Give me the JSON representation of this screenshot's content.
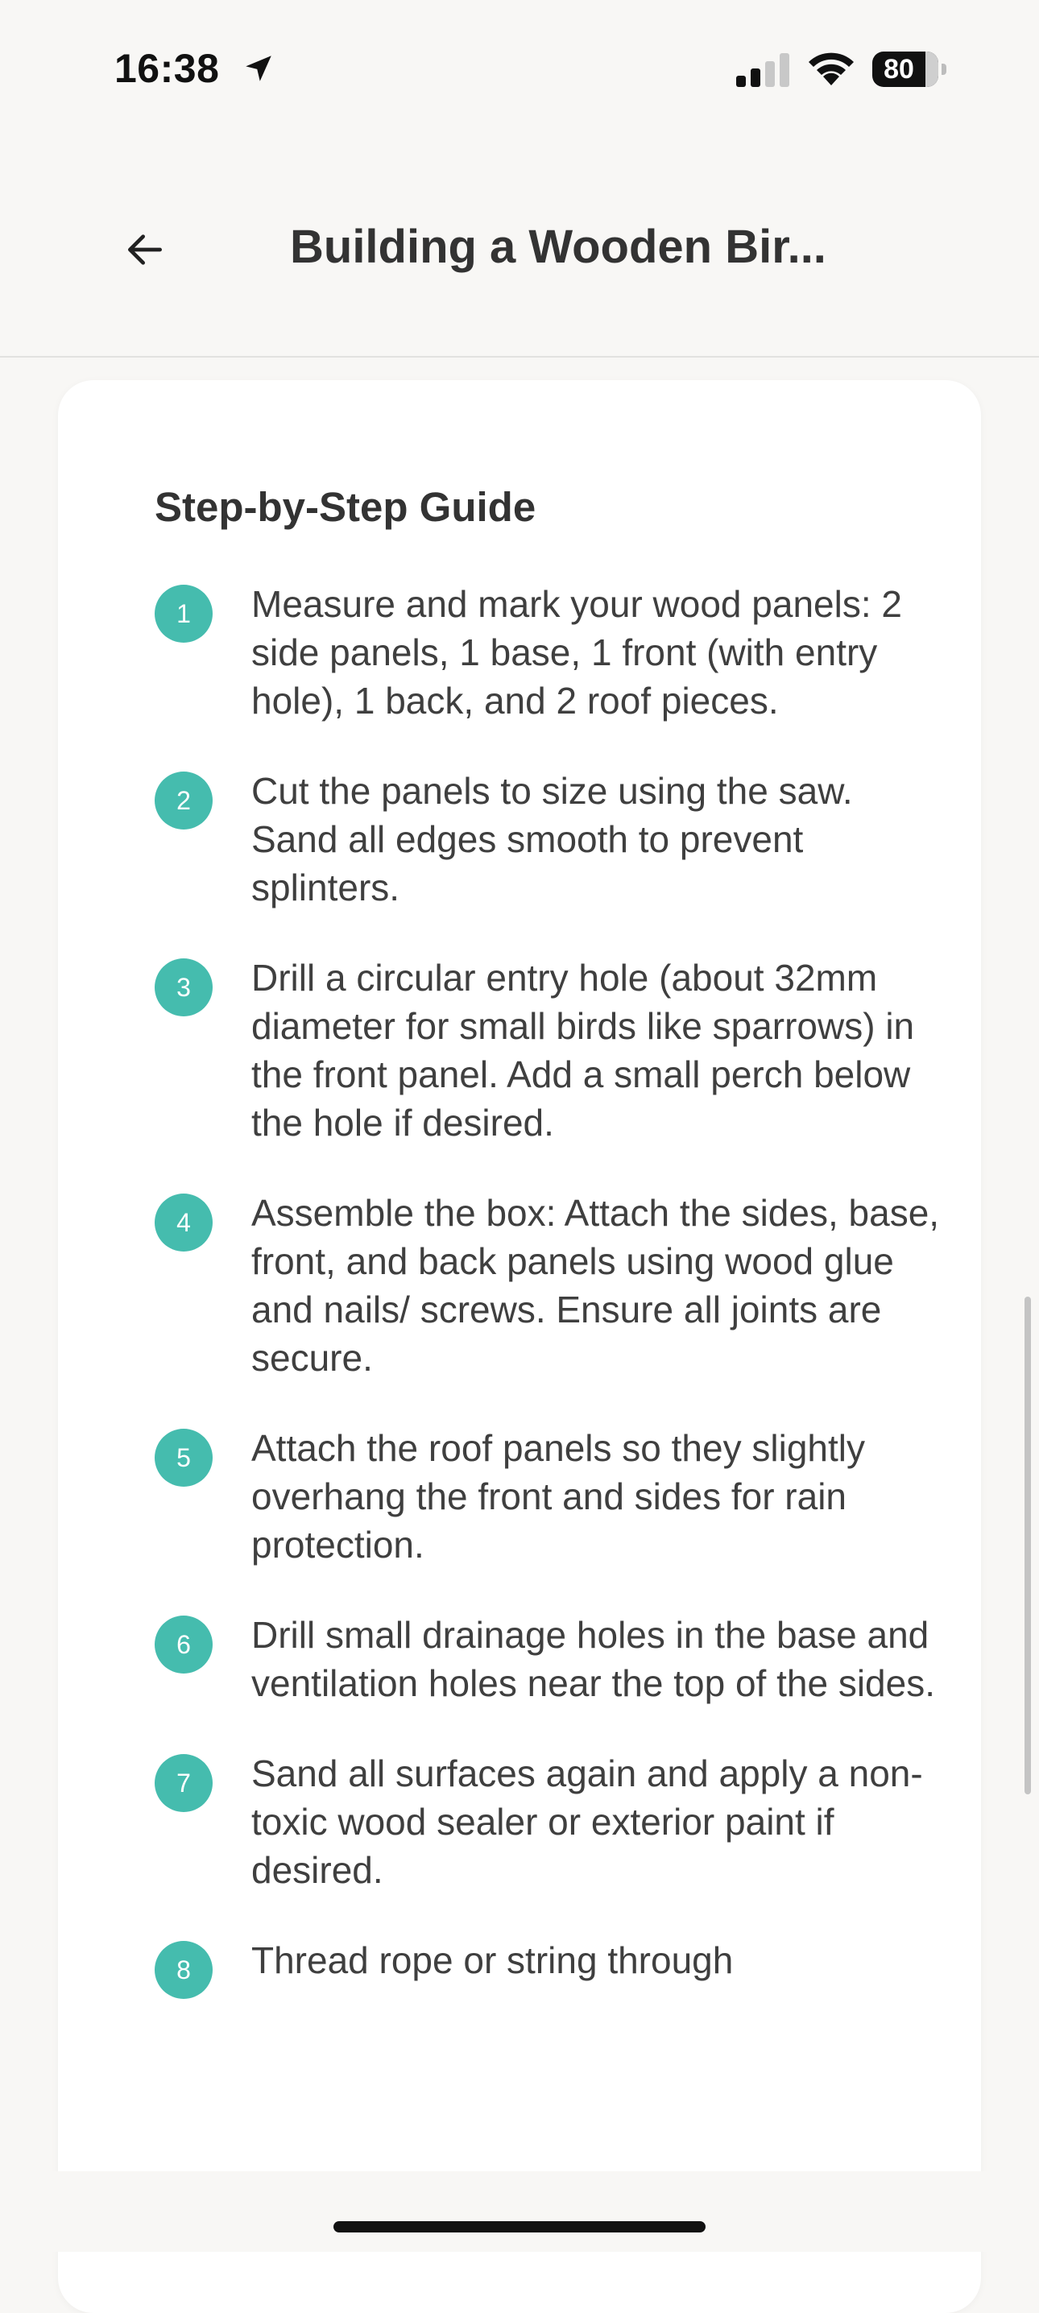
{
  "status_bar": {
    "time": "16:38",
    "battery": "80",
    "icons": [
      "location-arrow-icon",
      "cellular-signal-icon",
      "wifi-icon",
      "battery-icon"
    ]
  },
  "header": {
    "back_icon": "arrow-left-icon",
    "title": "Building a Wooden Bir..."
  },
  "guide": {
    "title": "Step-by-Step Guide",
    "accent_color": "#45bcae",
    "steps": [
      {
        "number": "1",
        "text": "Measure and mark your wood panels: 2 side panels, 1 base, 1 front (with entry hole), 1 back, and 2 roof pieces."
      },
      {
        "number": "2",
        "text": "Cut the panels to size using the saw. Sand all edges smooth to prevent splinters."
      },
      {
        "number": "3",
        "text": "Drill a circular entry hole (about 32mm diameter for small birds like sparrows) in the front panel. Add a small perch below the hole if desired."
      },
      {
        "number": "4",
        "text": "Assemble the box: Attach the sides, base, front, and back panels using wood glue and nails/ screws. Ensure all joints are secure."
      },
      {
        "number": "5",
        "text": "Attach the roof panels so they slightly overhang the front and sides for rain protection."
      },
      {
        "number": "6",
        "text": "Drill small drainage holes in the base and ventilation holes near the top of the sides."
      },
      {
        "number": "7",
        "text": "Sand all surfaces again and apply a non-toxic wood sealer or exterior paint if desired."
      },
      {
        "number": "8",
        "text": "Thread rope or string through"
      }
    ]
  }
}
